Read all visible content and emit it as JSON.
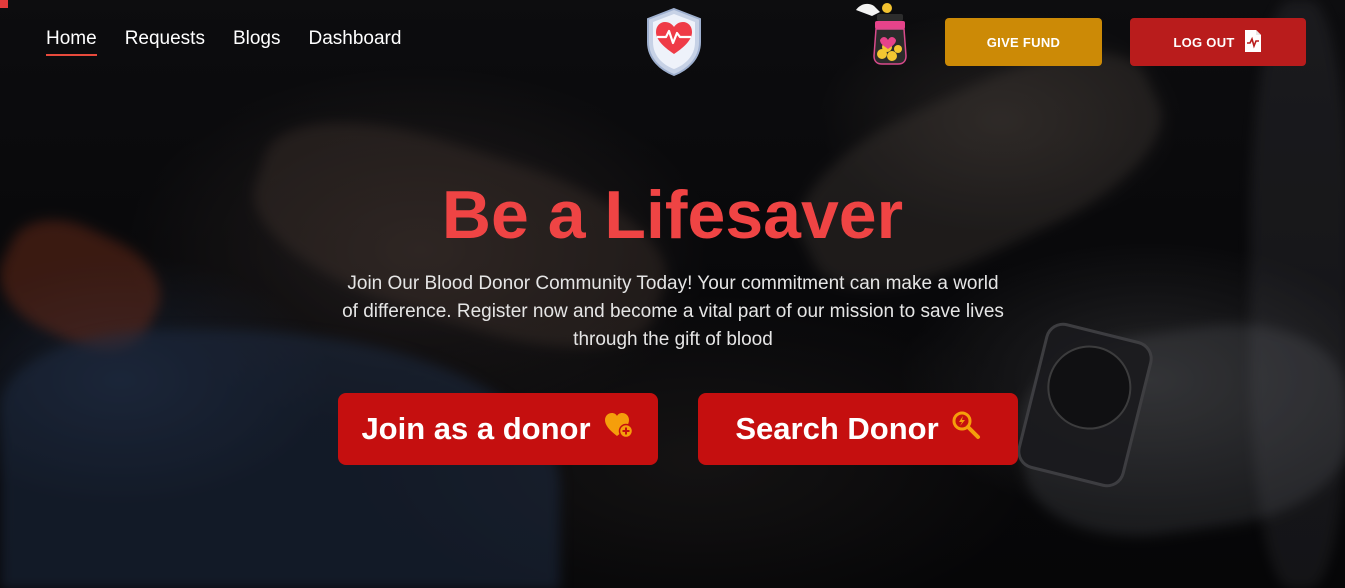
{
  "nav": {
    "items": [
      {
        "label": "Home",
        "active": true
      },
      {
        "label": "Requests",
        "active": false
      },
      {
        "label": "Blogs",
        "active": false
      },
      {
        "label": "Dashboard",
        "active": false
      }
    ]
  },
  "header": {
    "logo_icon": "heart-shield-icon",
    "fund_icon": "donation-jar-icon",
    "give_fund_label": "GIVE FUND",
    "logout_label": "LOG OUT",
    "logout_icon": "document-pulse-icon"
  },
  "hero": {
    "title": "Be a Lifesaver",
    "subtitle": "Join Our Blood Donor Community Today! Your commitment can make a world of difference. Register now and become a vital part of our mission to save lives through the gift of blood",
    "join_label": "Join as a donor",
    "join_icon": "heart-plus-icon",
    "search_label": "Search Donor",
    "search_icon": "magnifier-icon"
  },
  "colors": {
    "accent_red": "#ef4444",
    "button_red": "#c50f0f",
    "fund_gold": "#cc8a06",
    "logout_red": "#b91c1c",
    "icon_orange": "#f59e0b"
  }
}
